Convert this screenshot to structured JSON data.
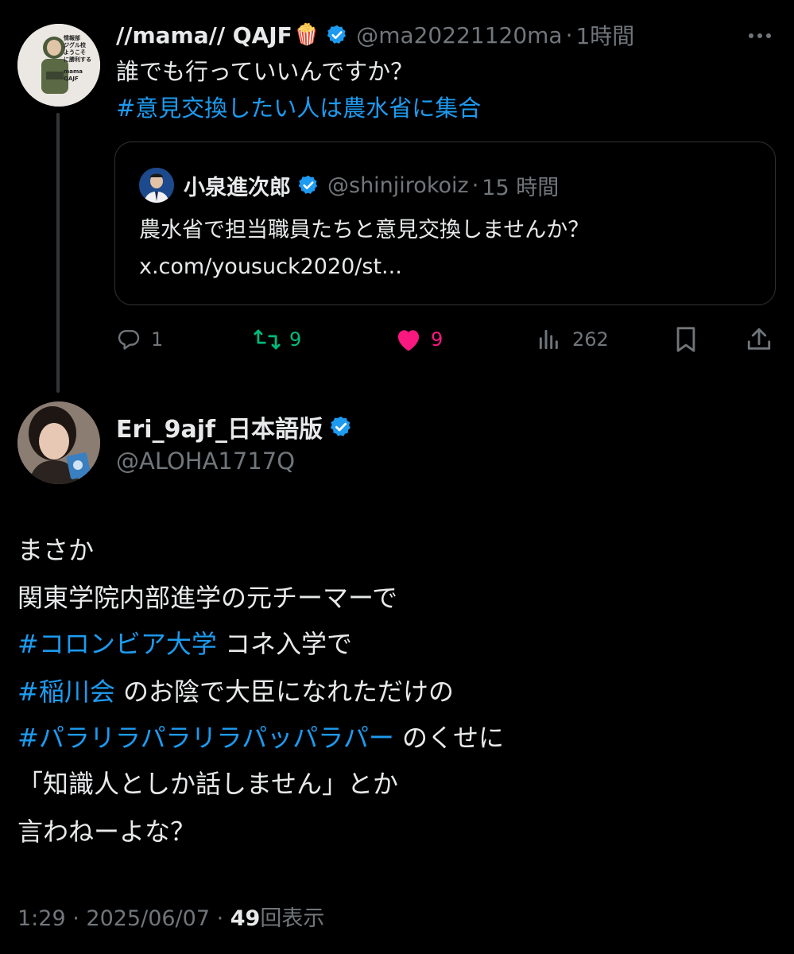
{
  "tweet1": {
    "display_name": "//mama// QAJF",
    "emoji": "🍿",
    "handle": "@ma20221120ma",
    "sep": "·",
    "time": "1時間",
    "text_line1": "誰でも行っていいんですか？",
    "hashtag": "#意見交換したい人は農水省に集合",
    "avatar_lines": [
      "情報部",
      "ジグル校",
      "ようこそ",
      "に勝利する",
      "mama",
      "QAJF"
    ]
  },
  "quote": {
    "display_name": "小泉進次郎",
    "handle": "@shinjirokoiz",
    "sep": "·",
    "time": "15 時間",
    "text": "農水省で担当職員たちと意見交換しませんか？",
    "link": "x.com/yousuck2020/st..."
  },
  "actions": {
    "reply_count": "1",
    "retweet_count": "9",
    "like_count": "9",
    "views_count": "262"
  },
  "tweet2": {
    "display_name": "Eri_9ajf_日本語版",
    "handle": "@ALOHA1717Q",
    "lines": {
      "l1": "まさか",
      "l2": "関東学院内部進学の元チーマーで",
      "l3_tag": "#コロンビア大学",
      "l3_rest": " コネ入学で",
      "l4_tag": "#稲川会",
      "l4_rest": " のお陰で大臣になれただけの",
      "l5_tag": "#パラリラパラリラパッパラパー",
      "l5_rest": " のくせに",
      "l6": "「知識人としか話しません」とか",
      "l7": "言わねーよな？"
    },
    "meta_time": "1:29",
    "meta_sep1": " · ",
    "meta_date": "2025/06/07",
    "meta_sep2": " · ",
    "meta_views": "49",
    "meta_views_label": "回表示"
  },
  "colors": {
    "accent_blue": "#1d9bf0",
    "retweet_green": "#00ba7c",
    "like_pink": "#f91880",
    "muted_gray": "#71767b"
  },
  "icons": [
    "more-icon",
    "verified-icon",
    "reply-icon",
    "retweet-icon",
    "like-icon",
    "views-icon",
    "bookmark-icon",
    "share-icon"
  ]
}
